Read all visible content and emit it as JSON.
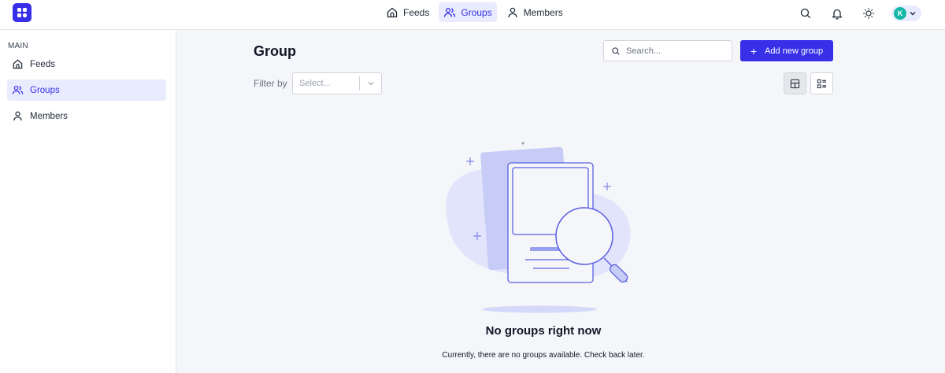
{
  "topnav": [
    {
      "label": "Feeds",
      "icon": "home-icon",
      "active": false
    },
    {
      "label": "Groups",
      "icon": "users-icon",
      "active": true
    },
    {
      "label": "Members",
      "icon": "user-icon",
      "active": false
    }
  ],
  "user": {
    "initial": "K"
  },
  "sidebar": {
    "section_title": "MAIN",
    "items": [
      {
        "label": "Feeds",
        "icon": "home-icon",
        "active": false
      },
      {
        "label": "Groups",
        "icon": "users-icon",
        "active": true
      },
      {
        "label": "Members",
        "icon": "user-icon",
        "active": false
      }
    ]
  },
  "main": {
    "title": "Group",
    "search_placeholder": "Search...",
    "add_button_label": "Add new group",
    "filter_label": "Filter by",
    "filter_placeholder": "Select...",
    "empty_title": "No groups right now",
    "empty_description": "Currently, there are no groups available. Check back later."
  },
  "colors": {
    "accent": "#3730e8",
    "accent_bg": "#e9ebfe",
    "avatar": "#14b8a6"
  }
}
